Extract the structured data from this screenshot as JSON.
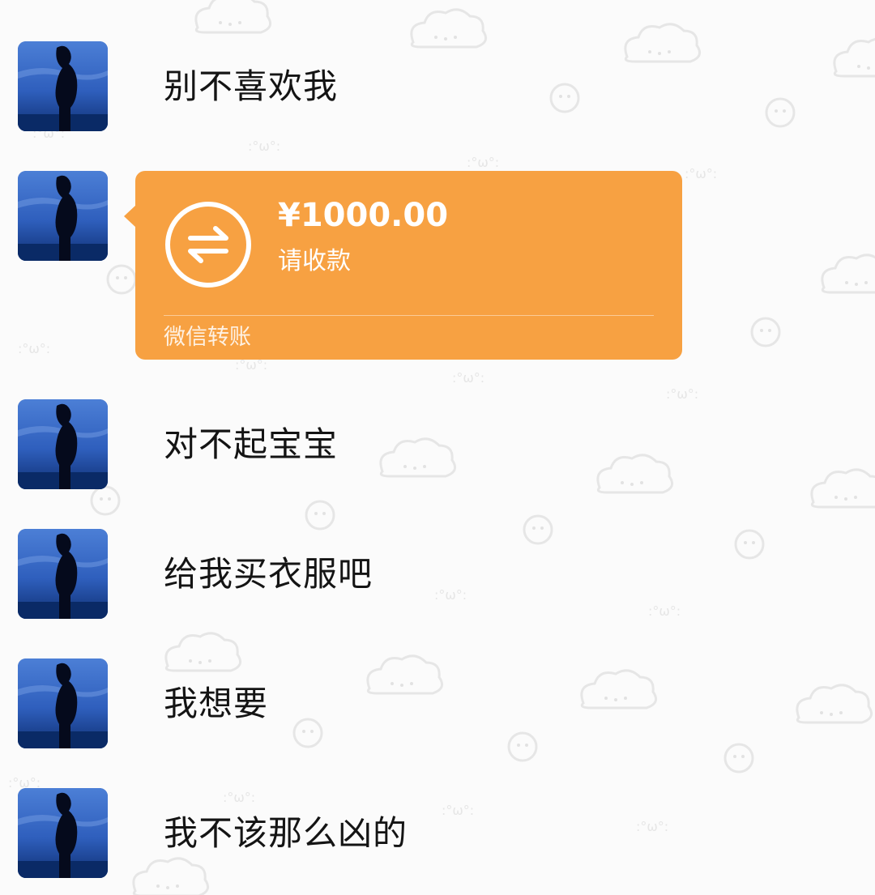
{
  "conversation": {
    "messages": [
      {
        "type": "text",
        "text": "别不喜欢我"
      },
      {
        "type": "transfer",
        "amount": "¥1000.00",
        "status": "请收款",
        "footer": "微信转账"
      },
      {
        "type": "text",
        "text": "对不起宝宝"
      },
      {
        "type": "text",
        "text": "给我买衣服吧"
      },
      {
        "type": "text",
        "text": "我想要"
      },
      {
        "type": "text",
        "text": "我不该那么凶的"
      }
    ]
  },
  "icons": {
    "transfer": "transfer-arrows-icon",
    "avatar": "silhouette-avatar",
    "background": "cartoon-cloud-doodle-pattern"
  },
  "colors": {
    "background": "#fbfbfb",
    "transfer_bubble": "#f7a142",
    "text": "#141414",
    "avatar_sky": "#2d5cb8"
  }
}
